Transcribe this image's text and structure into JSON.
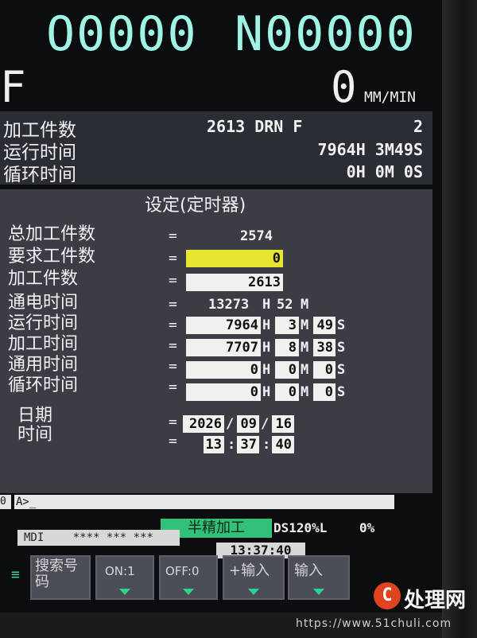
{
  "header": {
    "program_number": "O0000",
    "sequence_number": "N00000",
    "feed_letter": "F",
    "feed_value": "0",
    "feed_unit": "MM/MIN"
  },
  "info": {
    "rows": [
      {
        "label": "加工件数",
        "mid": "2613 DRN F",
        "value": "2"
      },
      {
        "label": "运行时间",
        "mid": "",
        "value": "7964H 3M49S"
      },
      {
        "label": "循环时间",
        "mid": "",
        "value": "0H 0M 0S"
      }
    ]
  },
  "settings": {
    "title": "设定(定时器)",
    "equals": "=",
    "total_parts": {
      "label": "总加工件数",
      "value": "2574"
    },
    "required_parts": {
      "label": "要求工件数",
      "value": "0"
    },
    "parts_count": {
      "label": "加工件数",
      "value": "2613"
    },
    "power_on_time": {
      "label": "通电时间",
      "hours": "13273",
      "h_unit": "H",
      "minutes": "52",
      "m_unit": "M"
    },
    "run_time": {
      "label": "运行时间",
      "hours": "7964",
      "minutes": "3",
      "seconds": "49"
    },
    "cutting_time": {
      "label": "加工时间",
      "hours": "7707",
      "minutes": "8",
      "seconds": "38"
    },
    "general_time": {
      "label": "通用时间",
      "hours": "0",
      "minutes": "0",
      "seconds": "0"
    },
    "cycle_time": {
      "label": "循环时间",
      "hours": "0",
      "minutes": "0",
      "seconds": "0"
    },
    "units": {
      "h": "H",
      "m": "M",
      "s": "S"
    },
    "date": {
      "label": "日期",
      "year": "2026",
      "month": "09",
      "day": "16",
      "sep": "/"
    },
    "time": {
      "label": "时间",
      "hour": "13",
      "minute": "37",
      "second": "40",
      "sep": ":"
    }
  },
  "command": {
    "left_char": "0",
    "prompt": "A>_"
  },
  "status": {
    "mode": "半精加工",
    "info": "DS120%L",
    "percent": "0%",
    "mdi": "MDI",
    "stars": "**** *** ***",
    "clock": "13:37:40"
  },
  "softkeys": [
    {
      "label": "搜索号码"
    },
    {
      "label": "ON:1"
    },
    {
      "label": "OFF:0"
    },
    {
      "label": "+输入"
    },
    {
      "label": "输入"
    }
  ],
  "watermark": "https://www.51chuli.com",
  "logo": {
    "glyph": "C",
    "text": "处理网"
  }
}
